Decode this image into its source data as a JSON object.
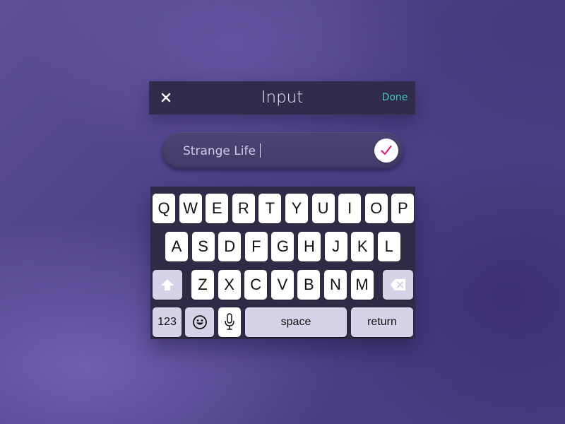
{
  "header": {
    "title": "Input",
    "done_label": "Done",
    "close_icon": "close-icon"
  },
  "input": {
    "value": "Strange Life",
    "confirm_icon": "checkmark-icon"
  },
  "keyboard": {
    "row1": [
      "Q",
      "W",
      "E",
      "R",
      "T",
      "Y",
      "U",
      "I",
      "O",
      "P"
    ],
    "row2": [
      "A",
      "S",
      "D",
      "F",
      "G",
      "H",
      "J",
      "K",
      "L"
    ],
    "row3": [
      "Z",
      "X",
      "C",
      "V",
      "B",
      "N",
      "M"
    ],
    "numbers_label": "123",
    "space_label": "space",
    "return_label": "return",
    "icons": [
      "shift-icon",
      "backspace-icon",
      "emoji-icon",
      "microphone-icon"
    ]
  },
  "colors": {
    "accent_done": "#3fc7c4",
    "accent_check": "#e6197e",
    "header_bg": "#322c4c",
    "keyboard_bg": "#2f2a45",
    "function_key_bg": "#d6d3e9"
  }
}
